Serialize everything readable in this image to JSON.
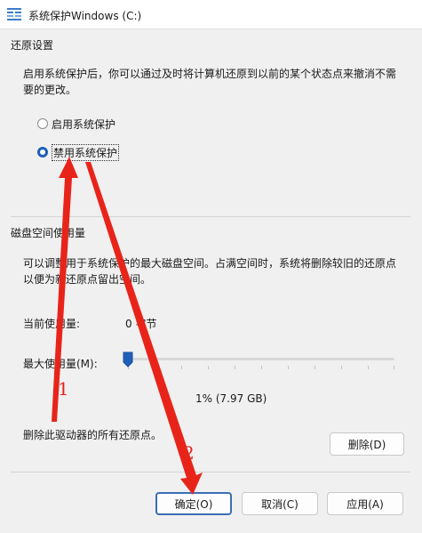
{
  "window": {
    "title": "系统保护Windows (C:)"
  },
  "restore": {
    "section_title": "还原设置",
    "description_line1": "启用系统保护后，你可以通过及时将计算机还原到以前的某个状态点来撤消不需",
    "description_line2": "要的更改。",
    "options": [
      {
        "label": "启用系统保护",
        "selected": false
      },
      {
        "label": "禁用系统保护",
        "selected": true
      }
    ]
  },
  "disk": {
    "section_title": "磁盘空间使用量",
    "description_line1": "可以调整用于系统保护的最大磁盘空间。占满空间时，系统将删除较旧的还原点",
    "description_line2": "以便为新还原点留出空间。",
    "current_usage_label": "当前使用量:",
    "current_usage_value": "0 字节",
    "max_usage_label": "最大使用量(M):",
    "max_usage_percent": 1,
    "max_usage_value": "1% (7.97 GB)",
    "delete_text": "删除此驱动器的所有还原点。",
    "delete_button": "删除(D)"
  },
  "footer": {
    "ok": "确定(O)",
    "cancel": "取消(C)",
    "apply": "应用(A)"
  },
  "annotations": {
    "step1": "1",
    "step2": "2",
    "color": "#e8241a"
  },
  "colors": {
    "accent": "#1f5fb8"
  }
}
